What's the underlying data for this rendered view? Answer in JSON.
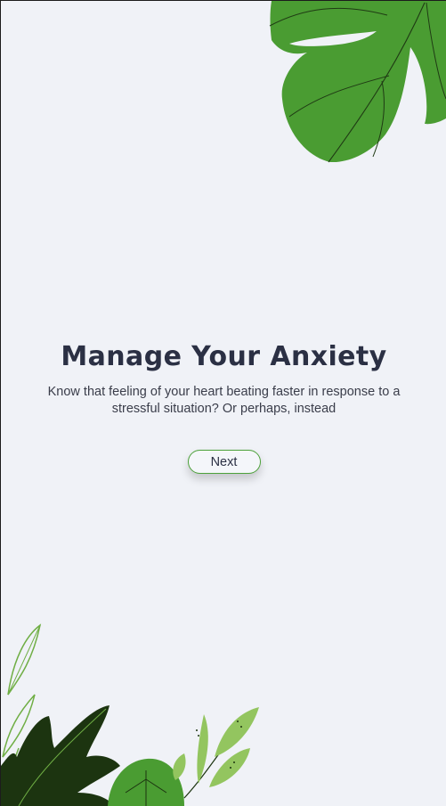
{
  "screen": {
    "title": "Manage Your Anxiety",
    "description": "Know that feeling of your heart beating faster in response to a stressful situation? Or perhaps, instead",
    "next_label": "Next"
  },
  "decorations": {
    "top_right": "monstera-leaf-icon",
    "bottom_left": "plants-illustration-icon"
  },
  "colors": {
    "background": "#f0f2f7",
    "leaf_green": "#4a9c32",
    "dark_green": "#1c3410",
    "light_green": "#93c55f",
    "title": "#2b3044",
    "button_border": "#4ca13a"
  }
}
